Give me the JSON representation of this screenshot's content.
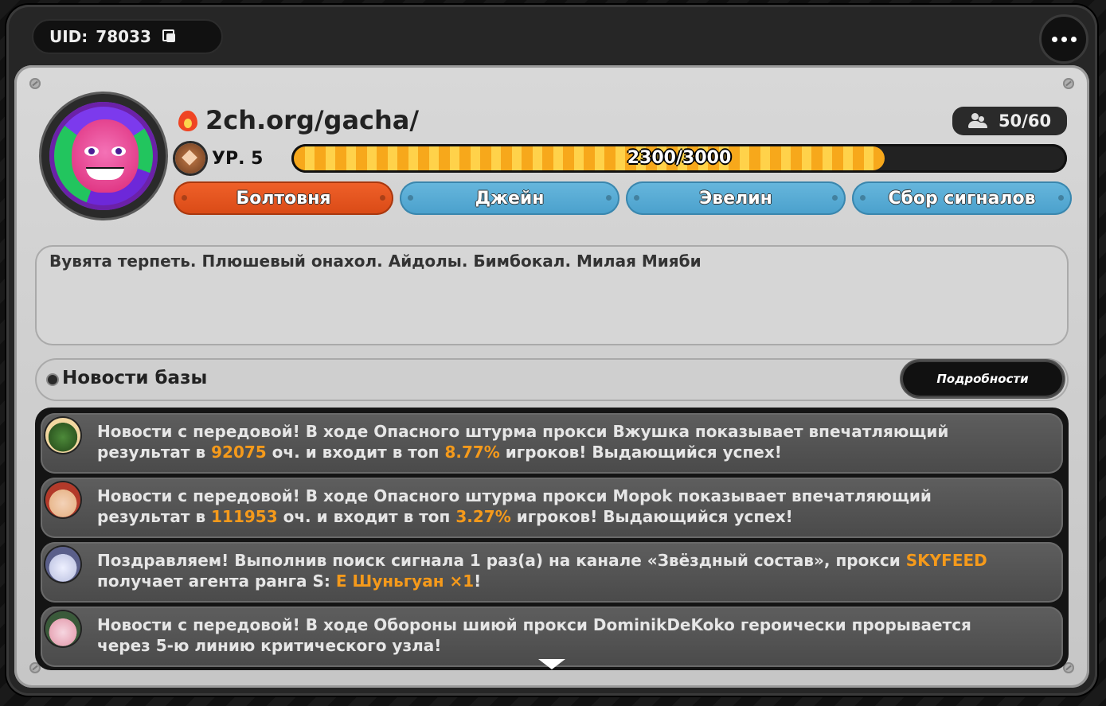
{
  "uid": {
    "label": "UID:",
    "value": "78033",
    "copy_icon": "copy-icon"
  },
  "menu": {
    "icon": "more-dots-icon"
  },
  "profile": {
    "title": "2ch.org/gacha/",
    "members": "50/60",
    "level_label": "УР. 5",
    "xp_text": "2300/3000",
    "xp_progress": 0.7667
  },
  "tags": [
    {
      "label": "Болтовня",
      "color": "#e85a22"
    },
    {
      "label": "Джейн",
      "color": "#58a9d5"
    },
    {
      "label": "Эвелин",
      "color": "#58a9d5"
    },
    {
      "label": "Сбор сигналов",
      "color": "#58a9d5"
    }
  ],
  "bio": "Вувята терпеть. Плюшевый онахол. Айдолы. Бимбокал. Милая Мияби",
  "news": {
    "title": "Новости базы",
    "details_button": "Подробности",
    "highlight_color": "#f59a1b",
    "items": [
      {
        "line1": "Новости с передовой! В ходе Опасного штурма прокси Вжушка показывает впечатляющий",
        "l2_pre": "результат в ",
        "l2_hl1": "92075",
        "l2_mid": " оч. и входит в топ ",
        "l2_hl2": "8.77%",
        "l2_post": " игроков! Выдающийся успех!"
      },
      {
        "line1": "Новости с передовой! В ходе Опасного штурма прокси Морok показывает впечатляющий",
        "l2_pre": "результат в ",
        "l2_hl1": "111953",
        "l2_mid": " оч. и входит в топ ",
        "l2_hl2": "3.27%",
        "l2_post": " игроков! Выдающийся успех!"
      },
      {
        "line1_pre": "Поздравляем! Выполнив поиск сигнала 1 раз(а) на канале «Звёздный состав», прокси ",
        "line1_hl": "SKYFEED",
        "l2_pre": "получает агента ранга S: ",
        "l2_hl1": "Е Шуньгуан ×1",
        "l2_post": "!"
      },
      {
        "line1": "Новости с передовой! В ходе Обороны шиюй прокси DominikDeKoko героически прорывается",
        "line2": "через 5-ю линию критического узла!"
      }
    ]
  }
}
